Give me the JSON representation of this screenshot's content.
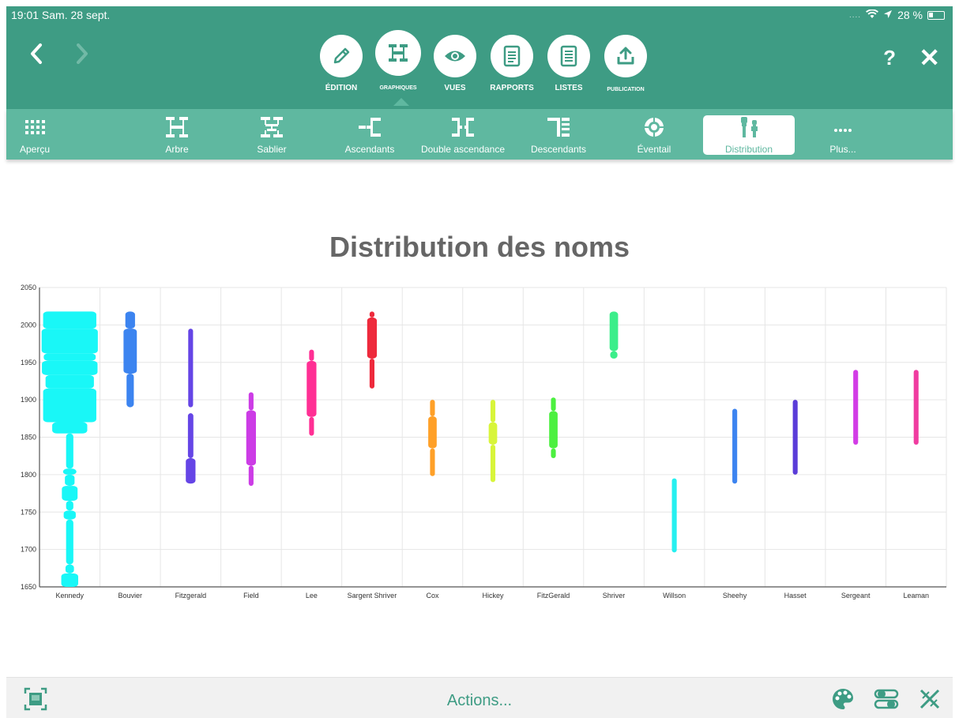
{
  "status": {
    "time_date": "19:01  Sam. 28 sept.",
    "battery": "28 %"
  },
  "toolbar": {
    "modes": [
      {
        "label": "ÉDITION",
        "icon": "pencil-icon"
      },
      {
        "label": "GRAPHIQUES",
        "icon": "tree-chart-icon"
      },
      {
        "label": "VUES",
        "icon": "eye-icon"
      },
      {
        "label": "RAPPORTS",
        "icon": "document-icon"
      },
      {
        "label": "LISTES",
        "icon": "list-icon"
      },
      {
        "label": "PUBLICATION",
        "icon": "share-icon"
      }
    ],
    "help": "?",
    "close": "✕"
  },
  "chart_tabs": [
    {
      "label": "Aperçu",
      "icon": "grid-icon"
    },
    {
      "label": "Arbre",
      "icon": "tree-icon"
    },
    {
      "label": "Sablier",
      "icon": "hourglass-icon"
    },
    {
      "label": "Ascendants",
      "icon": "ascendants-icon"
    },
    {
      "label": "Double ascendance",
      "icon": "double-ancestry-icon"
    },
    {
      "label": "Descendants",
      "icon": "descendants-icon"
    },
    {
      "label": "Éventail",
      "icon": "fan-icon"
    },
    {
      "label": "Distribution",
      "icon": "distribution-icon"
    },
    {
      "label": "Plus...",
      "icon": "more-icon"
    }
  ],
  "selected_tab": "Distribution",
  "bottom": {
    "actions_label": "Actions..."
  },
  "chart_data": {
    "type": "distribution",
    "title": "Distribution des noms",
    "ylim": [
      1650,
      2050
    ],
    "yticks": [
      1650,
      1700,
      1750,
      1800,
      1850,
      1900,
      1950,
      2000,
      2050
    ],
    "grid": true,
    "categories": [
      "Kennedy",
      "Bouvier",
      "Fitzgerald",
      "Field",
      "Lee",
      "Sargent Shriver",
      "Cox",
      "Hickey",
      "FitzGerald",
      "Shriver",
      "Willson",
      "Sheehy",
      "Hasset",
      "Sergeant",
      "Leaman"
    ],
    "series": [
      {
        "color": "#19f7f7",
        "segments": [
          [
            1650,
            1668,
            0.28
          ],
          [
            1668,
            1680,
            0.14
          ],
          [
            1680,
            1740,
            0.12
          ],
          [
            1740,
            1752,
            0.2
          ],
          [
            1752,
            1765,
            0.12
          ],
          [
            1765,
            1785,
            0.26
          ],
          [
            1785,
            1800,
            0.16
          ],
          [
            1800,
            1808,
            0.22
          ],
          [
            1808,
            1855,
            0.12
          ],
          [
            1855,
            1870,
            0.58
          ],
          [
            1870,
            1915,
            0.88
          ],
          [
            1915,
            1933,
            0.8
          ],
          [
            1933,
            1952,
            0.92
          ],
          [
            1952,
            1962,
            0.86
          ],
          [
            1962,
            1995,
            0.93
          ],
          [
            1995,
            2018,
            0.88
          ]
        ]
      },
      {
        "color": "#3c84f0",
        "segments": [
          [
            1890,
            1935,
            0.12
          ],
          [
            1935,
            1995,
            0.22
          ],
          [
            1995,
            2018,
            0.16
          ]
        ]
      },
      {
        "color": "#6545e6",
        "segments": [
          [
            1788,
            1822,
            0.16
          ],
          [
            1822,
            1882,
            0.09
          ],
          [
            1890,
            1995,
            0.08
          ]
        ]
      },
      {
        "color": "#cc3ce6",
        "segments": [
          [
            1785,
            1812,
            0.08
          ],
          [
            1812,
            1886,
            0.16
          ],
          [
            1886,
            1910,
            0.08
          ]
        ]
      },
      {
        "color": "#ff2f94",
        "segments": [
          [
            1852,
            1877,
            0.08
          ],
          [
            1877,
            1952,
            0.16
          ],
          [
            1952,
            1967,
            0.08
          ]
        ]
      },
      {
        "color": "#ee2a3c",
        "segments": [
          [
            1915,
            1955,
            0.08
          ],
          [
            1955,
            2010,
            0.16
          ],
          [
            2010,
            2018,
            0.08
          ]
        ]
      },
      {
        "color": "#ffa028",
        "segments": [
          [
            1798,
            1835,
            0.08
          ],
          [
            1835,
            1878,
            0.14
          ],
          [
            1878,
            1900,
            0.08
          ]
        ]
      },
      {
        "color": "#d8f53a",
        "segments": [
          [
            1790,
            1840,
            0.08
          ],
          [
            1840,
            1870,
            0.14
          ],
          [
            1870,
            1900,
            0.08
          ]
        ]
      },
      {
        "color": "#4cf040",
        "segments": [
          [
            1822,
            1835,
            0.08
          ],
          [
            1835,
            1885,
            0.14
          ],
          [
            1885,
            1903,
            0.08
          ]
        ]
      },
      {
        "color": "#3cee8a",
        "segments": [
          [
            1955,
            1965,
            0.12
          ],
          [
            1965,
            2018,
            0.14
          ]
        ]
      },
      {
        "color": "#26f0f0",
        "segments": [
          [
            1696,
            1795,
            0.08
          ]
        ]
      },
      {
        "color": "#3c84f0",
        "segments": [
          [
            1788,
            1888,
            0.08
          ]
        ]
      },
      {
        "color": "#5a3cd8",
        "segments": [
          [
            1800,
            1900,
            0.08
          ]
        ]
      },
      {
        "color": "#d23ce6",
        "segments": [
          [
            1840,
            1940,
            0.08
          ]
        ]
      },
      {
        "color": "#f03ca0",
        "segments": [
          [
            1840,
            1940,
            0.08
          ]
        ]
      }
    ]
  }
}
